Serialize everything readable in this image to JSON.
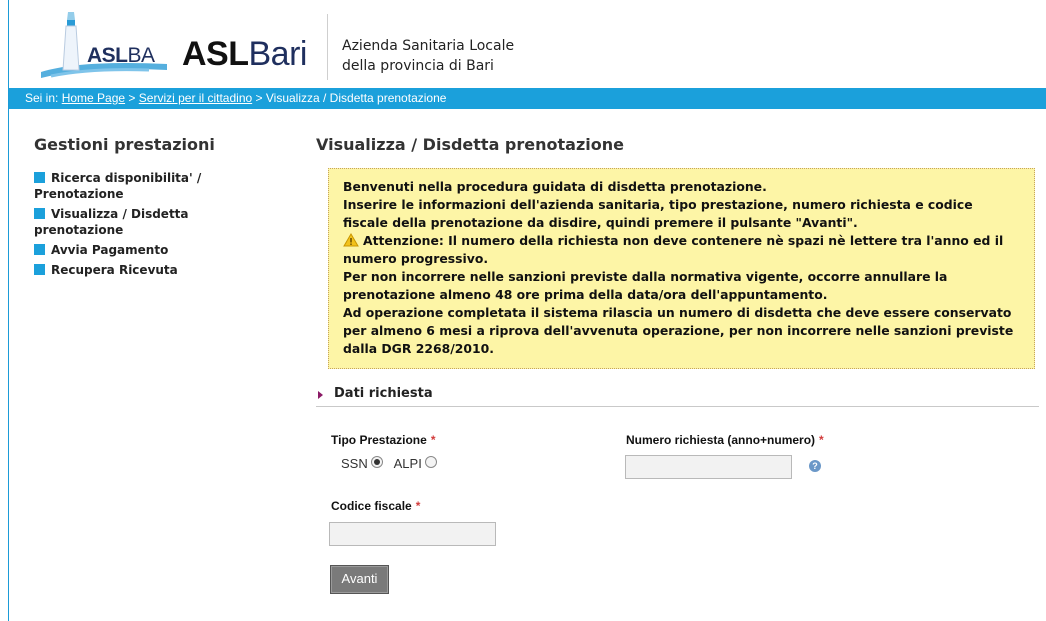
{
  "header": {
    "aslba_logo": {
      "bold": "ASL",
      "normal": "BA"
    },
    "aslbari_logo": {
      "bold": "ASL",
      "light": "Bari"
    },
    "azienda_line1": "Azienda Sanitaria Locale",
    "azienda_line2": "della provincia di Bari"
  },
  "breadcrumb": {
    "prefix": "Sei in:",
    "home": "Home Page",
    "sep1": ">",
    "servizi": "Servizi per il cittadino",
    "sep2": ">",
    "current": "Visualizza / Disdetta prenotazione"
  },
  "sidebar": {
    "title": "Gestioni prestazioni",
    "items": [
      {
        "label": "Ricerca disponibilita' / Prenotazione"
      },
      {
        "label": "Visualizza / Disdetta prenotazione"
      },
      {
        "label": "Avvia Pagamento"
      },
      {
        "label": "Recupera Ricevuta"
      }
    ]
  },
  "main": {
    "title": "Visualizza / Disdetta prenotazione",
    "notice": {
      "p1": "Benvenuti nella procedura guidata di disdetta prenotazione.",
      "p2": "Inserire le informazioni dell'azienda sanitaria, tipo prestazione, numero richiesta e codice fiscale della prenotazione da disdire, quindi premere il pulsante \"Avanti\".",
      "p3": "Attenzione: Il numero della richiesta non deve contenere nè spazi nè lettere tra l'anno ed il numero progressivo.",
      "p4": "Per non incorrere nelle sanzioni previste dalla normativa vigente, occorre annullare la prenotazione almeno 48 ore prima della data/ora dell'appuntamento.",
      "p5": "Ad operazione completata il sistema rilascia un numero di disdetta che deve essere conservato per almeno 6 mesi a riprova dell'avvenuta operazione, per non incorrere nelle sanzioni previste dalla DGR 2268/2010."
    },
    "section_title": "Dati richiesta",
    "form": {
      "tipo_label": "Tipo Prestazione",
      "required_mark": "*",
      "ssn_label": "SSN",
      "alpi_label": "ALPI",
      "selected": "SSN",
      "numero_label": "Numero richiesta (anno+numero)",
      "numero_value": "",
      "help_glyph": "?",
      "codice_label": "Codice fiscale",
      "codice_value": "",
      "submit_label": "Avanti"
    }
  },
  "colors": {
    "accent": "#1ba0db",
    "notice_bg": "#fdf5a6",
    "required": "#d23b3b",
    "button": "#7a7a7a"
  }
}
